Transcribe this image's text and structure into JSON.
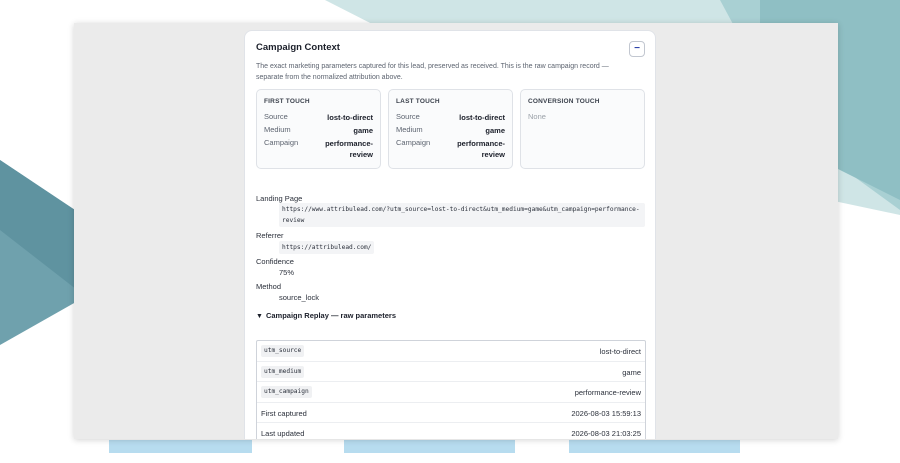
{
  "colors": {
    "background_teal_dark": "#6fa1ad",
    "background_teal_light": "#a9d0d3",
    "background_teal_pale": "#cfe5e6",
    "strip_blue": "#b7dcef",
    "window": "#ebebeb",
    "accent": "#2a3fa8"
  },
  "campaign_context": {
    "title": "Campaign Context",
    "collapse_label": "−",
    "description": "The exact marketing parameters captured for this lead, preserved as received. This is the raw campaign record — separate from the normalized attribution above.",
    "touches": [
      {
        "heading": "FIRST TOUCH",
        "rows": [
          {
            "key": "Source",
            "value": "lost-to-direct"
          },
          {
            "key": "Medium",
            "value": "game"
          },
          {
            "key": "Campaign",
            "value": "performance-review"
          }
        ]
      },
      {
        "heading": "LAST TOUCH",
        "rows": [
          {
            "key": "Source",
            "value": "lost-to-direct"
          },
          {
            "key": "Medium",
            "value": "game"
          },
          {
            "key": "Campaign",
            "value": "performance-review"
          }
        ]
      },
      {
        "heading": "CONVERSION TOUCH",
        "empty_text": "None"
      }
    ],
    "landing_page": {
      "label": "Landing Page",
      "value": "https://www.attribulead.com/?utm_source=lost-to-direct&utm_medium=game&utm_campaign=performance-review"
    },
    "referrer": {
      "label": "Referrer",
      "value": "https://attribulead.com/"
    },
    "confidence": {
      "label": "Confidence",
      "value": "75%"
    },
    "method": {
      "label": "Method",
      "value": "source_lock"
    },
    "replay": {
      "toggle_icon": "caret-down-icon",
      "toggle_arrow": "▼",
      "toggle_label": "Campaign Replay — raw parameters",
      "rows": [
        {
          "key": "utm_source",
          "value": "lost-to-direct",
          "code": true
        },
        {
          "key": "utm_medium",
          "value": "game",
          "code": true
        },
        {
          "key": "utm_campaign",
          "value": "performance-review",
          "code": true
        },
        {
          "key": "First captured",
          "value": "2026-08-03 15:59:13",
          "code": false
        },
        {
          "key": "Last updated",
          "value": "2026-08-03 21:03:25",
          "code": false
        }
      ]
    }
  }
}
